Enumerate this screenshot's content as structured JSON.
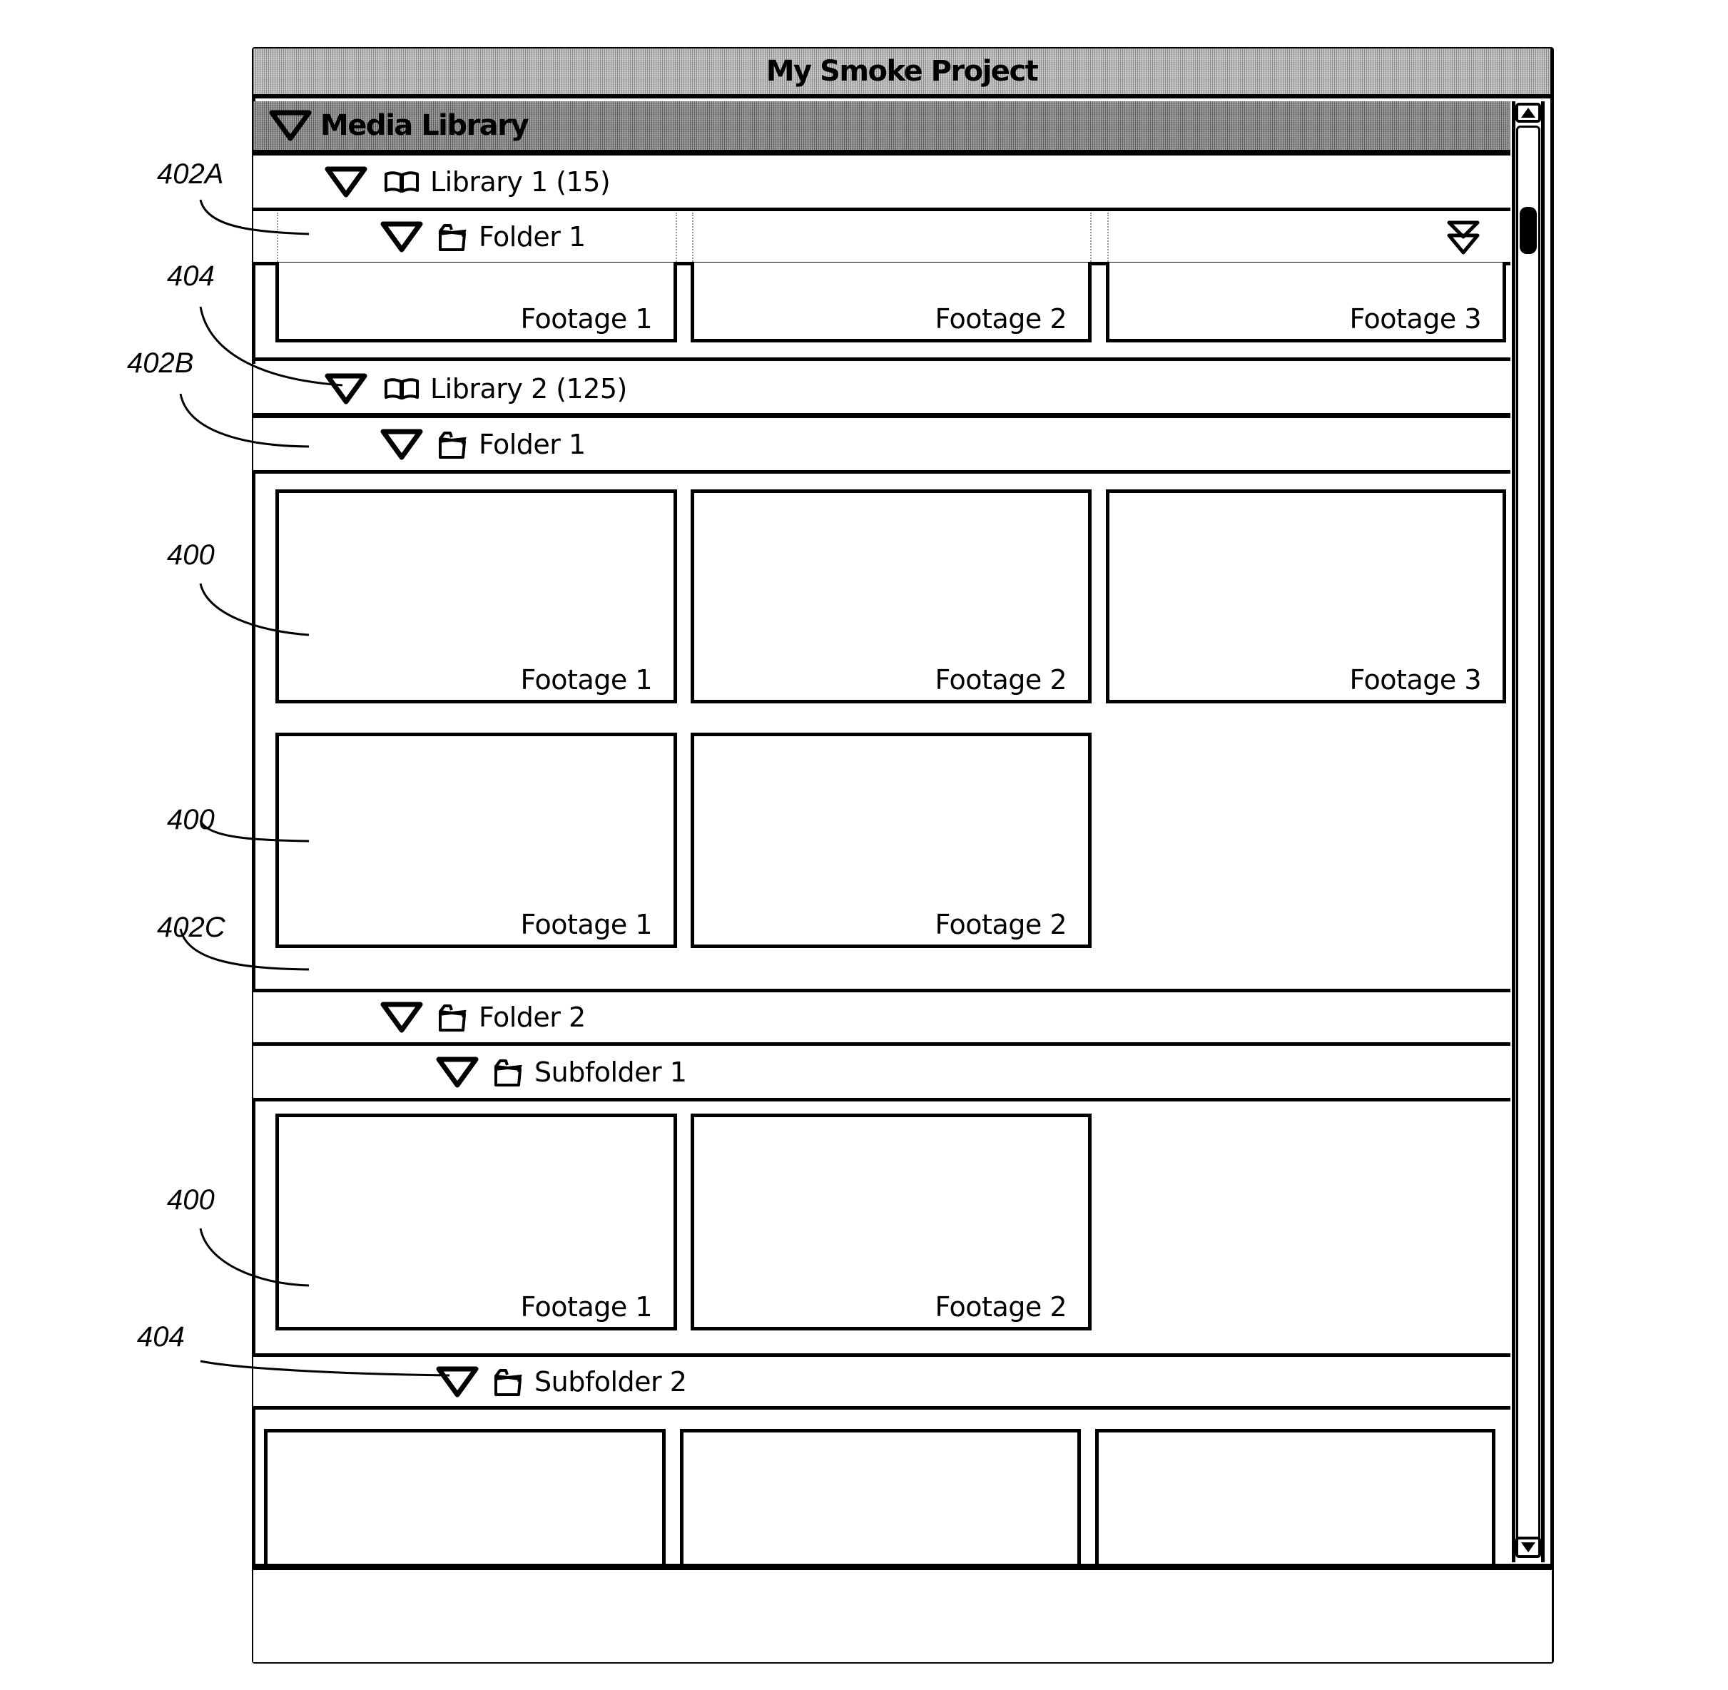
{
  "window": {
    "title": "My Smoke Project"
  },
  "media_library": {
    "label": "Media Library",
    "expand_icon": "triangle-down-icon"
  },
  "libraries": [
    {
      "label": "Library 1 (15)",
      "icon": "book-icon",
      "folders": [
        {
          "label": "Folder 1",
          "icon": "folder-icon",
          "collapse_all_icon": "double-chevron-down-icon",
          "footage": [
            "Footage 1",
            "Footage 2",
            "Footage 3"
          ]
        }
      ]
    },
    {
      "label": "Library 2 (125)",
      "icon": "book-icon",
      "folders": [
        {
          "label": "Folder 1",
          "icon": "folder-icon",
          "footage": [
            "Footage 1",
            "Footage 2",
            "Footage 3",
            "Footage 1",
            "Footage 2"
          ]
        },
        {
          "label": "Folder 2",
          "icon": "folder-icon",
          "subfolders": [
            {
              "label": "Subfolder 1",
              "icon": "folder-icon",
              "footage": [
                "Footage 1",
                "Footage 2"
              ]
            },
            {
              "label": "Subfolder 2",
              "icon": "folder-icon",
              "footage": [
                "",
                "",
                ""
              ]
            }
          ]
        }
      ]
    }
  ],
  "scrollbar": {
    "up_icon": "arrow-up-icon",
    "down_icon": "arrow-down-icon"
  },
  "annotations": {
    "a402A": "402A",
    "a404_top": "404",
    "a402B": "402B",
    "a400_1": "400",
    "a400_2": "400",
    "a402C": "402C",
    "a400_3": "400",
    "a404_bottom": "404"
  }
}
